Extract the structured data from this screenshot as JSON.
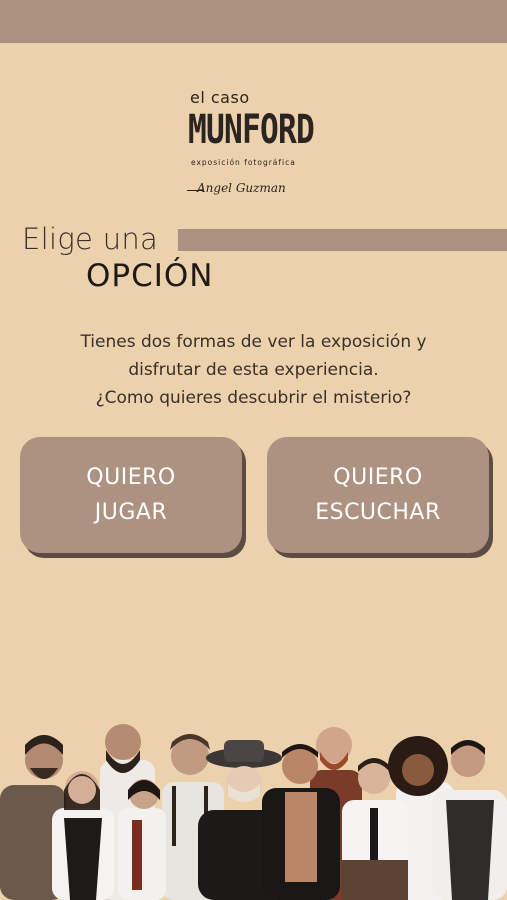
{
  "logo": {
    "small": "el caso",
    "main": "MUNFORD",
    "sub": "exposición fotográfica",
    "signature": "Angel Guzman"
  },
  "heading": {
    "line1": "Elige una",
    "line2": "OPCIÓN"
  },
  "intro": {
    "line1": "Tienes dos formas de ver la exposición y",
    "line2": "disfrutar de esta experiencia.",
    "line3": "¿Como quieres descubrir el misterio?"
  },
  "options": {
    "play": {
      "line1": "QUIERO",
      "line2": "JUGAR"
    },
    "listen": {
      "line1": "QUIERO",
      "line2": "ESCUCHAR"
    }
  },
  "colors": {
    "background": "#ecd1ad",
    "accent": "#ae9281",
    "button_shadow": "#5d4c42",
    "text_dark": "#1f1a17"
  }
}
